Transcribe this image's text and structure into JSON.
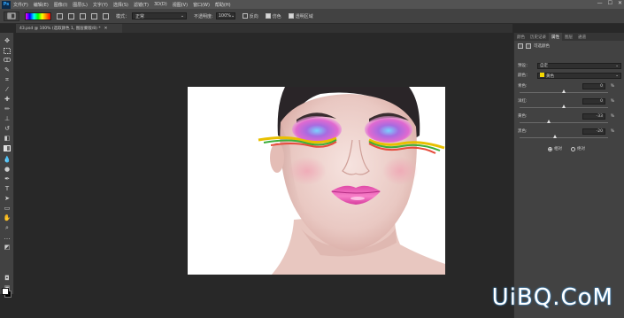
{
  "menubar": {
    "logo": "Ps",
    "items": [
      "文件(F)",
      "编辑(E)",
      "图像(I)",
      "图层(L)",
      "文字(Y)",
      "选择(S)",
      "滤镜(T)",
      "3D(D)",
      "视图(V)",
      "窗口(W)",
      "帮助(H)"
    ],
    "window_controls": [
      "—",
      "☐",
      "✕"
    ]
  },
  "options": {
    "mode_label": "模式：",
    "mode_value": "正常",
    "opacity_label": "不透明度:",
    "opacity_value": "100%",
    "reverse_label": "反向",
    "reverse_checked": false,
    "dither_label": "仿色",
    "dither_checked": true,
    "transparency_label": "透明区域",
    "transparency_checked": true
  },
  "document": {
    "tab_title": "43.psd @ 100% (选取颜色 1, 图层蒙版/8) *",
    "close_glyph": "✕"
  },
  "panel": {
    "tabs": [
      "颜色",
      "历史记录",
      "属性",
      "图层",
      "通道"
    ],
    "active_tab": "属性",
    "title": "可选颜色",
    "preset_label": "预设：",
    "preset_value": "自定",
    "colors_label": "颜色：",
    "colors_value": "黄色",
    "sliders": [
      {
        "label": "青色:",
        "value": "0",
        "unit": "%",
        "fraction": 0.5
      },
      {
        "label": "洋红:",
        "value": "0",
        "unit": "%",
        "fraction": 0.5
      },
      {
        "label": "黄色:",
        "value": "-33",
        "unit": "%",
        "fraction": 0.33
      },
      {
        "label": "黑色:",
        "value": "-20",
        "unit": "%",
        "fraction": 0.4
      }
    ],
    "method_relative": "相对",
    "method_absolute": "绝对",
    "method_selected": "相对"
  },
  "colors": {
    "foreground": "#ffffff",
    "background": "#000000"
  },
  "watermark": "UiBQ.CoM"
}
